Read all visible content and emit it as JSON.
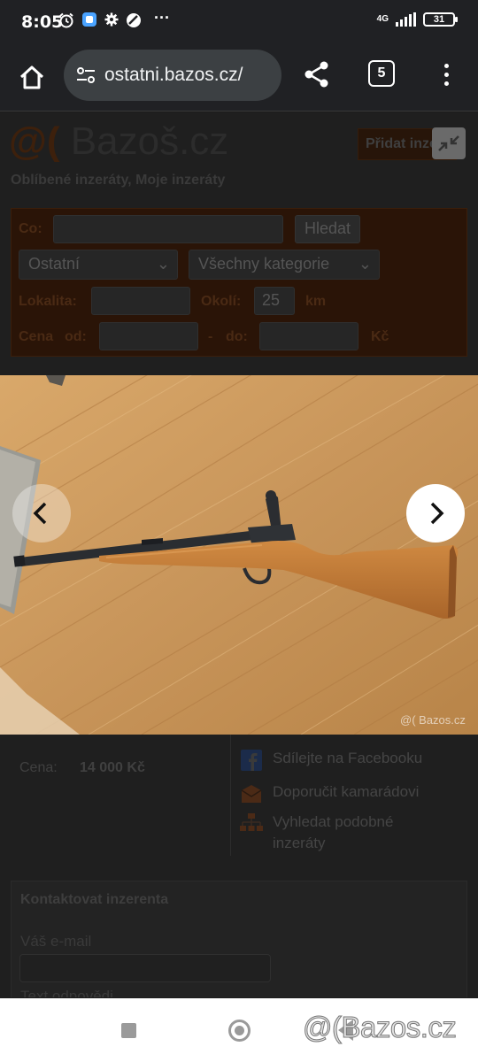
{
  "status_bar": {
    "time": "8:05",
    "network": "4G",
    "battery": "31",
    "more": "···"
  },
  "browser": {
    "url": "ostatni.bazos.cz/",
    "tab_count": "5"
  },
  "page": {
    "logo_at": "@(",
    "logo_text": "Bazoš.cz",
    "add_ad_label": "Přidat inzerát",
    "fav_links": "Oblíbené inzeráty, Moje inzeráty",
    "search": {
      "co_label": "Co:",
      "search_button": "Hledat",
      "section_select": "Ostatní",
      "category_select": "Všechny kategorie",
      "locality_label": "Lokalita:",
      "radius_label": "Okolí:",
      "radius_value": "25",
      "radius_unit": "km",
      "price_label": "Cena",
      "price_from": "od:",
      "price_sep": "-",
      "price_to": "do:",
      "currency": "Kč"
    },
    "price_label": "Cena:",
    "price_value": "14 000 Kč",
    "side_links": {
      "facebook": "Sdílejte na Facebooku",
      "recommend": "Doporučit kamarádovi",
      "similar_line1": "Vyhledat podobné",
      "similar_line2": "inzeráty"
    },
    "contact": {
      "title": "Kontaktovat inzerenta",
      "email_label": "Váš e-mail",
      "reply_label": "Text odpovědi"
    }
  },
  "photo_viewer": {
    "credit": "@( Bazos.cz"
  },
  "watermark": "@(Bazos.cz",
  "colors": {
    "brand": "#ff6600",
    "photo_floor": "#c8955a",
    "stock": "#c27a37"
  }
}
